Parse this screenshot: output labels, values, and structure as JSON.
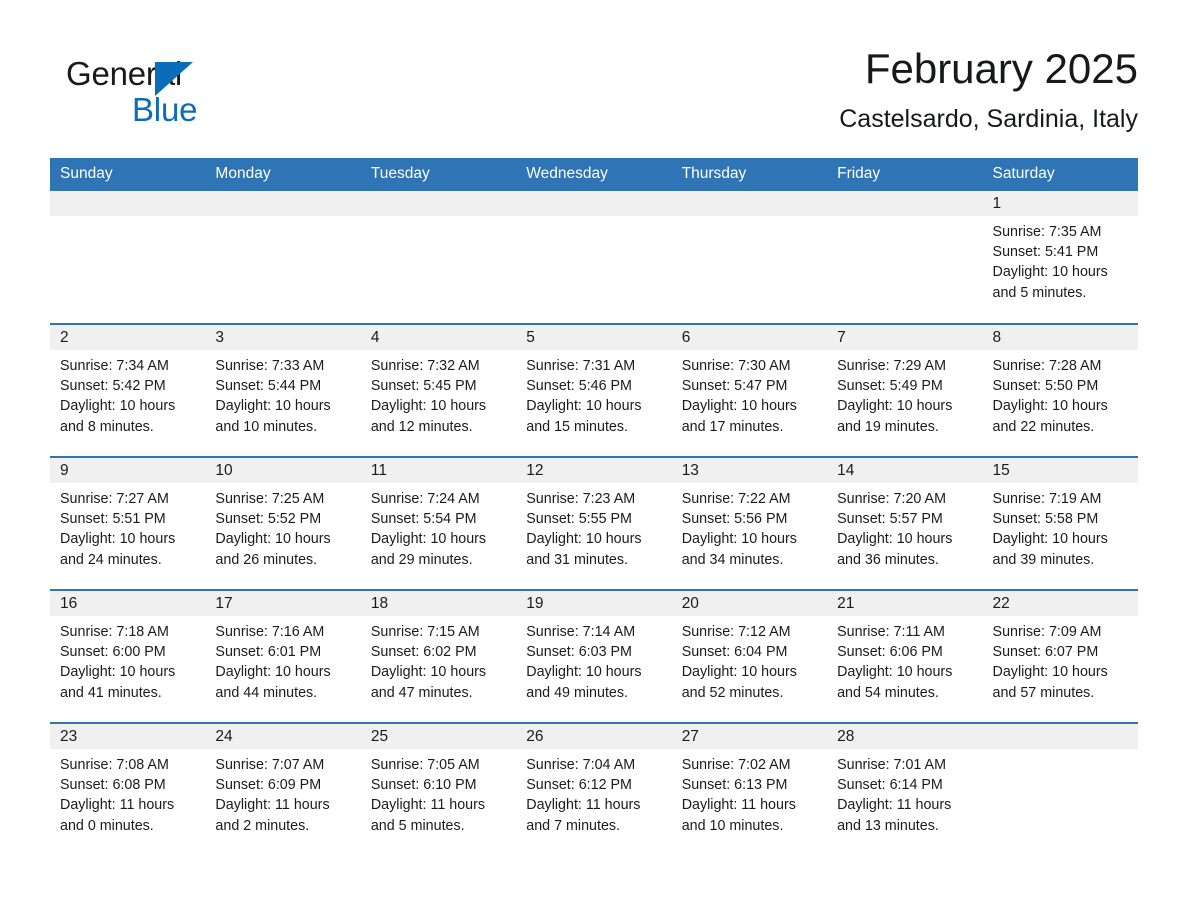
{
  "brand": {
    "name_part1": "General",
    "name_part2": "Blue",
    "triangle_color": "#0b6cb7"
  },
  "header": {
    "month_title": "February 2025",
    "location": "Castelsardo, Sardinia, Italy"
  },
  "theme": {
    "header_blue": "#2f74b5",
    "date_band_gray": "#f0f0f0",
    "text_color": "#1b1b1b"
  },
  "weekday_headers": [
    "Sunday",
    "Monday",
    "Tuesday",
    "Wednesday",
    "Thursday",
    "Friday",
    "Saturday"
  ],
  "weeks": [
    [
      {
        "date": "",
        "sunrise": "",
        "sunset": "",
        "daylight_1": "",
        "daylight_2": ""
      },
      {
        "date": "",
        "sunrise": "",
        "sunset": "",
        "daylight_1": "",
        "daylight_2": ""
      },
      {
        "date": "",
        "sunrise": "",
        "sunset": "",
        "daylight_1": "",
        "daylight_2": ""
      },
      {
        "date": "",
        "sunrise": "",
        "sunset": "",
        "daylight_1": "",
        "daylight_2": ""
      },
      {
        "date": "",
        "sunrise": "",
        "sunset": "",
        "daylight_1": "",
        "daylight_2": ""
      },
      {
        "date": "",
        "sunrise": "",
        "sunset": "",
        "daylight_1": "",
        "daylight_2": ""
      },
      {
        "date": "1",
        "sunrise": "Sunrise: 7:35 AM",
        "sunset": "Sunset: 5:41 PM",
        "daylight_1": "Daylight: 10 hours",
        "daylight_2": "and 5 minutes."
      }
    ],
    [
      {
        "date": "2",
        "sunrise": "Sunrise: 7:34 AM",
        "sunset": "Sunset: 5:42 PM",
        "daylight_1": "Daylight: 10 hours",
        "daylight_2": "and 8 minutes."
      },
      {
        "date": "3",
        "sunrise": "Sunrise: 7:33 AM",
        "sunset": "Sunset: 5:44 PM",
        "daylight_1": "Daylight: 10 hours",
        "daylight_2": "and 10 minutes."
      },
      {
        "date": "4",
        "sunrise": "Sunrise: 7:32 AM",
        "sunset": "Sunset: 5:45 PM",
        "daylight_1": "Daylight: 10 hours",
        "daylight_2": "and 12 minutes."
      },
      {
        "date": "5",
        "sunrise": "Sunrise: 7:31 AM",
        "sunset": "Sunset: 5:46 PM",
        "daylight_1": "Daylight: 10 hours",
        "daylight_2": "and 15 minutes."
      },
      {
        "date": "6",
        "sunrise": "Sunrise: 7:30 AM",
        "sunset": "Sunset: 5:47 PM",
        "daylight_1": "Daylight: 10 hours",
        "daylight_2": "and 17 minutes."
      },
      {
        "date": "7",
        "sunrise": "Sunrise: 7:29 AM",
        "sunset": "Sunset: 5:49 PM",
        "daylight_1": "Daylight: 10 hours",
        "daylight_2": "and 19 minutes."
      },
      {
        "date": "8",
        "sunrise": "Sunrise: 7:28 AM",
        "sunset": "Sunset: 5:50 PM",
        "daylight_1": "Daylight: 10 hours",
        "daylight_2": "and 22 minutes."
      }
    ],
    [
      {
        "date": "9",
        "sunrise": "Sunrise: 7:27 AM",
        "sunset": "Sunset: 5:51 PM",
        "daylight_1": "Daylight: 10 hours",
        "daylight_2": "and 24 minutes."
      },
      {
        "date": "10",
        "sunrise": "Sunrise: 7:25 AM",
        "sunset": "Sunset: 5:52 PM",
        "daylight_1": "Daylight: 10 hours",
        "daylight_2": "and 26 minutes."
      },
      {
        "date": "11",
        "sunrise": "Sunrise: 7:24 AM",
        "sunset": "Sunset: 5:54 PM",
        "daylight_1": "Daylight: 10 hours",
        "daylight_2": "and 29 minutes."
      },
      {
        "date": "12",
        "sunrise": "Sunrise: 7:23 AM",
        "sunset": "Sunset: 5:55 PM",
        "daylight_1": "Daylight: 10 hours",
        "daylight_2": "and 31 minutes."
      },
      {
        "date": "13",
        "sunrise": "Sunrise: 7:22 AM",
        "sunset": "Sunset: 5:56 PM",
        "daylight_1": "Daylight: 10 hours",
        "daylight_2": "and 34 minutes."
      },
      {
        "date": "14",
        "sunrise": "Sunrise: 7:20 AM",
        "sunset": "Sunset: 5:57 PM",
        "daylight_1": "Daylight: 10 hours",
        "daylight_2": "and 36 minutes."
      },
      {
        "date": "15",
        "sunrise": "Sunrise: 7:19 AM",
        "sunset": "Sunset: 5:58 PM",
        "daylight_1": "Daylight: 10 hours",
        "daylight_2": "and 39 minutes."
      }
    ],
    [
      {
        "date": "16",
        "sunrise": "Sunrise: 7:18 AM",
        "sunset": "Sunset: 6:00 PM",
        "daylight_1": "Daylight: 10 hours",
        "daylight_2": "and 41 minutes."
      },
      {
        "date": "17",
        "sunrise": "Sunrise: 7:16 AM",
        "sunset": "Sunset: 6:01 PM",
        "daylight_1": "Daylight: 10 hours",
        "daylight_2": "and 44 minutes."
      },
      {
        "date": "18",
        "sunrise": "Sunrise: 7:15 AM",
        "sunset": "Sunset: 6:02 PM",
        "daylight_1": "Daylight: 10 hours",
        "daylight_2": "and 47 minutes."
      },
      {
        "date": "19",
        "sunrise": "Sunrise: 7:14 AM",
        "sunset": "Sunset: 6:03 PM",
        "daylight_1": "Daylight: 10 hours",
        "daylight_2": "and 49 minutes."
      },
      {
        "date": "20",
        "sunrise": "Sunrise: 7:12 AM",
        "sunset": "Sunset: 6:04 PM",
        "daylight_1": "Daylight: 10 hours",
        "daylight_2": "and 52 minutes."
      },
      {
        "date": "21",
        "sunrise": "Sunrise: 7:11 AM",
        "sunset": "Sunset: 6:06 PM",
        "daylight_1": "Daylight: 10 hours",
        "daylight_2": "and 54 minutes."
      },
      {
        "date": "22",
        "sunrise": "Sunrise: 7:09 AM",
        "sunset": "Sunset: 6:07 PM",
        "daylight_1": "Daylight: 10 hours",
        "daylight_2": "and 57 minutes."
      }
    ],
    [
      {
        "date": "23",
        "sunrise": "Sunrise: 7:08 AM",
        "sunset": "Sunset: 6:08 PM",
        "daylight_1": "Daylight: 11 hours",
        "daylight_2": "and 0 minutes."
      },
      {
        "date": "24",
        "sunrise": "Sunrise: 7:07 AM",
        "sunset": "Sunset: 6:09 PM",
        "daylight_1": "Daylight: 11 hours",
        "daylight_2": "and 2 minutes."
      },
      {
        "date": "25",
        "sunrise": "Sunrise: 7:05 AM",
        "sunset": "Sunset: 6:10 PM",
        "daylight_1": "Daylight: 11 hours",
        "daylight_2": "and 5 minutes."
      },
      {
        "date": "26",
        "sunrise": "Sunrise: 7:04 AM",
        "sunset": "Sunset: 6:12 PM",
        "daylight_1": "Daylight: 11 hours",
        "daylight_2": "and 7 minutes."
      },
      {
        "date": "27",
        "sunrise": "Sunrise: 7:02 AM",
        "sunset": "Sunset: 6:13 PM",
        "daylight_1": "Daylight: 11 hours",
        "daylight_2": "and 10 minutes."
      },
      {
        "date": "28",
        "sunrise": "Sunrise: 7:01 AM",
        "sunset": "Sunset: 6:14 PM",
        "daylight_1": "Daylight: 11 hours",
        "daylight_2": "and 13 minutes."
      },
      {
        "date": "",
        "sunrise": "",
        "sunset": "",
        "daylight_1": "",
        "daylight_2": ""
      }
    ]
  ]
}
